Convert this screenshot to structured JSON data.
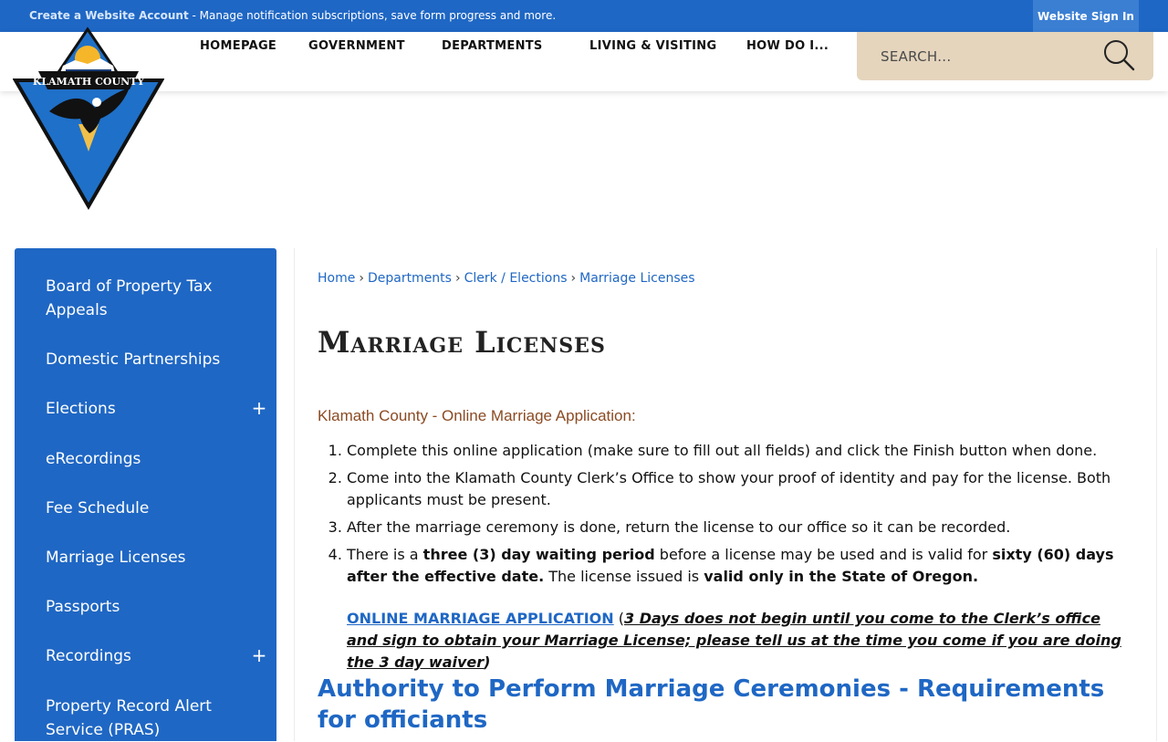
{
  "topbar": {
    "create_link": "Create a Website Account",
    "message": " - Manage notification subscriptions, save form progress and more.",
    "signin": "Website Sign In"
  },
  "logo": {
    "text": "KLAMATH COUNTY"
  },
  "nav": [
    "HOMEPAGE",
    "GOVERNMENT",
    "DEPARTMENTS",
    "LIVING & VISITING",
    "HOW DO I..."
  ],
  "search": {
    "placeholder": "SEARCH..."
  },
  "sidebar": {
    "items": [
      {
        "label": "Board of Property Tax Appeals",
        "expandable": false
      },
      {
        "label": "Domestic Partnerships",
        "expandable": false
      },
      {
        "label": "Elections",
        "expandable": true
      },
      {
        "label": "eRecordings",
        "expandable": false
      },
      {
        "label": "Fee Schedule",
        "expandable": false
      },
      {
        "label": "Marriage Licenses",
        "expandable": false
      },
      {
        "label": "Passports",
        "expandable": false
      },
      {
        "label": "Recordings",
        "expandable": true
      },
      {
        "label": "Property Record Alert Service (PRAS)",
        "expandable": false
      }
    ],
    "expand_symbol": "+"
  },
  "breadcrumb": [
    "Home",
    "Departments",
    "Clerk / Elections",
    "Marriage Licenses"
  ],
  "breadcrumb_sep": "›",
  "content": {
    "title": "Marriage Licenses",
    "subtitle": "Klamath County - Online Marriage Application:",
    "step1": "Complete this online application (make sure to fill out all fields) and click the Finish button when done.",
    "step2": "Come into the Klamath County Clerk’s Office to show your proof of identity and pay for the license. Both applicants must be present.",
    "step3": "After the marriage ceremony is done, return the license to our office so it can be recorded.",
    "step4": {
      "p1": "There is a ",
      "b1": "three (3) day waiting period",
      "p2": " before a license may be used and is valid for ",
      "b2": "sixty (60) days after the effective date.",
      "p3": " The license issued is ",
      "b3": "valid only in the State of Oregon."
    },
    "app_link": "ONLINE MARRIAGE APPLICATION",
    "app_note_open": " (",
    "app_note": "3 Days does not begin until you come to the Clerk’s office and sign to obtain your Marriage License; please tell us at the time you come if you are doing the 3 day waiver",
    "app_note_close": ")",
    "heading2": "Authority to Perform Marriage Ceremonies - Requirements for officiants"
  },
  "colors": {
    "brand_blue": "#1f67c4",
    "search_bg": "#e5d5bd",
    "subtitle": "#8b4a22"
  }
}
